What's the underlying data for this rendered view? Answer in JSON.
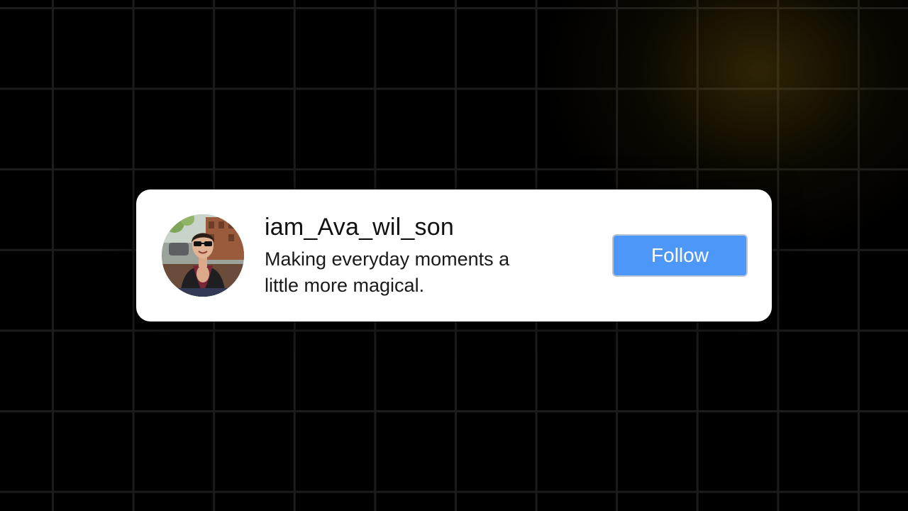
{
  "profile_card": {
    "username": "iam_Ava_wil_son",
    "bio": "Making everyday moments a little more magical.",
    "avatar_icon": "profile-photo",
    "follow_label": "Follow"
  },
  "colors": {
    "background": "#000000",
    "grid_line": "#1c1c1c",
    "card": "#ffffff",
    "follow_button": "#4c97f7",
    "follow_button_border": "#b9c6d6",
    "glow": "#6e550a"
  }
}
